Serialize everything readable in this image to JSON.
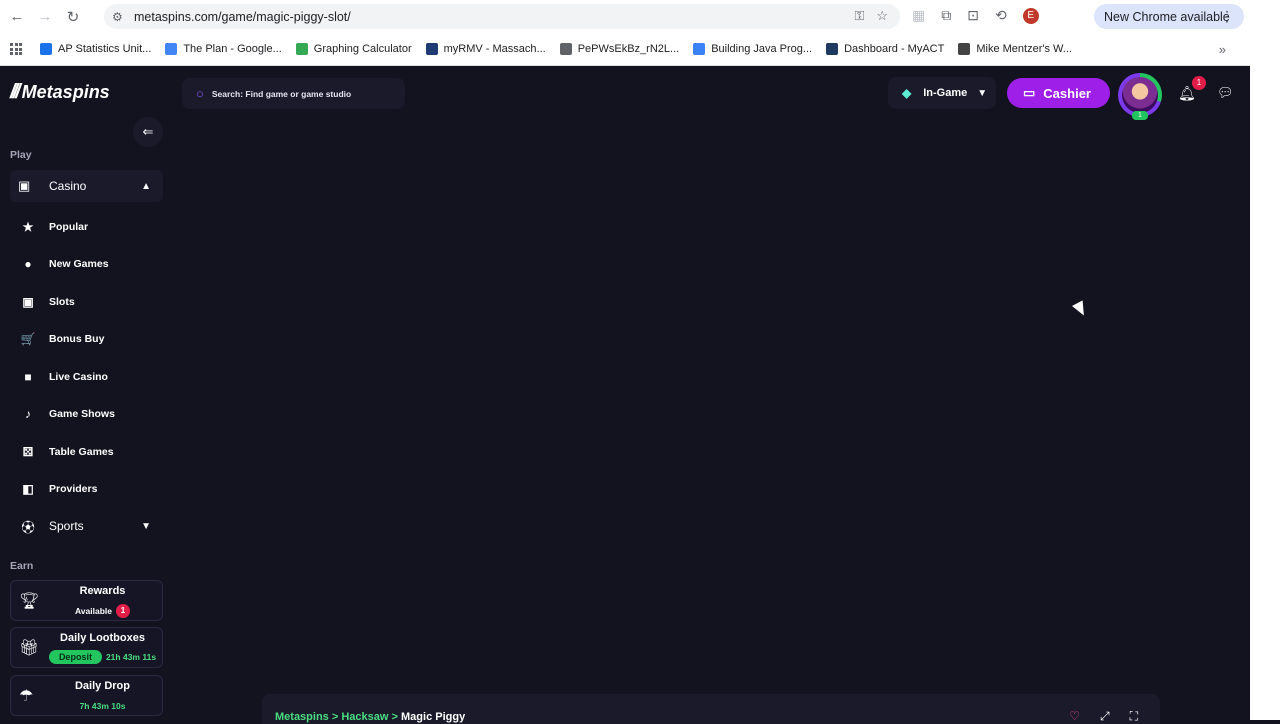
{
  "browser": {
    "url": "metaspins.com/game/magic-piggy-slot/",
    "update_label": "New Chrome available",
    "profile_initial": "E",
    "bookmarks": [
      {
        "label": "AP Statistics Unit...",
        "color": "#1a73e8"
      },
      {
        "label": "The Plan - Google...",
        "color": "#4285f4"
      },
      {
        "label": "Graphing Calculator",
        "color": "#34a853"
      },
      {
        "label": "myRMV - Massach...",
        "color": "#1f3b73"
      },
      {
        "label": "PePWsEkBz_rN2L...",
        "color": "#5f6368"
      },
      {
        "label": "Building Java Prog...",
        "color": "#3b82f6"
      },
      {
        "label": "Dashboard - MyACT",
        "color": "#1e3a5f"
      },
      {
        "label": "Mike Mentzer's W...",
        "color": "#444444"
      }
    ]
  },
  "header": {
    "brand": "Metaspins",
    "search_placeholder": "Search: Find game or game studio",
    "ingame_label": "In-Game",
    "cashier_label": "Cashier",
    "notification_count": "1",
    "avatar_level": "1"
  },
  "sidebar": {
    "play_label": "Play",
    "casino_label": "Casino",
    "items": [
      {
        "label": "Popular",
        "icon": "star-icon",
        "glyph": "★"
      },
      {
        "label": "New Games",
        "icon": "new-badge-icon",
        "glyph": "●"
      },
      {
        "label": "Slots",
        "icon": "slot-machine-icon",
        "glyph": "▣"
      },
      {
        "label": "Bonus Buy",
        "icon": "cart-icon",
        "glyph": "🛒"
      },
      {
        "label": "Live Casino",
        "icon": "video-camera-icon",
        "glyph": "■"
      },
      {
        "label": "Game Shows",
        "icon": "microphone-icon",
        "glyph": "♪"
      },
      {
        "label": "Table Games",
        "icon": "dice-icon",
        "glyph": "⚄"
      },
      {
        "label": "Providers",
        "icon": "tag-icon",
        "glyph": "◧"
      }
    ],
    "sports_label": "Sports",
    "earn_label": "Earn",
    "rewards": {
      "title": "Rewards",
      "sub": "Available",
      "badge": "1"
    },
    "lootboxes": {
      "title": "Daily Lootboxes",
      "button": "Deposit",
      "timer": "21h 43m 11s"
    },
    "drop": {
      "title": "Daily Drop",
      "timer": "7h 43m 10s"
    }
  },
  "game_bar": {
    "crumb_1": "Metaspins",
    "crumb_2": "Hacksaw",
    "crumb_3": "Magic Piggy",
    "separator": ">"
  }
}
